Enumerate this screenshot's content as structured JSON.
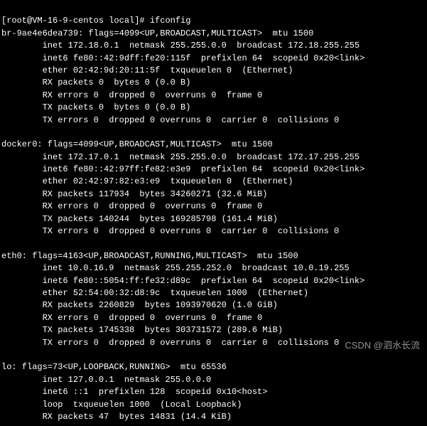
{
  "prompt": "[root@VM-16-9-centos local]# ",
  "command": "ifconfig",
  "interfaces": {
    "br": {
      "name": "br-9ae4e6dea739: flags=4099<UP,BROADCAST,MULTICAST>  mtu 1500",
      "inet": "        inet 172.18.0.1  netmask 255.255.0.0  broadcast 172.18.255.255",
      "inet6": "        inet6 fe80::42:9dff:fe20:115f  prefixlen 64  scopeid 0x20<link>",
      "ether": "        ether 02:42:9d:20:11:5f  txqueuelen 0  (Ethernet)",
      "rxp": "        RX packets 0  bytes 0 (0.0 B)",
      "rxe": "        RX errors 0  dropped 0  overruns 0  frame 0",
      "txp": "        TX packets 0  bytes 0 (0.0 B)",
      "txe": "        TX errors 0  dropped 0 overruns 0  carrier 0  collisions 0"
    },
    "docker0": {
      "name": "docker0: flags=4099<UP,BROADCAST,MULTICAST>  mtu 1500",
      "inet": "        inet 172.17.0.1  netmask 255.255.0.0  broadcast 172.17.255.255",
      "inet6": "        inet6 fe80::42:97ff:fe82:e3e9  prefixlen 64  scopeid 0x20<link>",
      "ether": "        ether 02:42:97:82:e3:e9  txqueuelen 0  (Ethernet)",
      "rxp": "        RX packets 117934  bytes 34260271 (32.6 MiB)",
      "rxe": "        RX errors 0  dropped 0  overruns 0  frame 0",
      "txp": "        TX packets 140244  bytes 169285798 (161.4 MiB)",
      "txe": "        TX errors 0  dropped 0 overruns 0  carrier 0  collisions 0"
    },
    "eth0": {
      "name": "eth0: flags=4163<UP,BROADCAST,RUNNING,MULTICAST>  mtu 1500",
      "inet": "        inet 10.0.16.9  netmask 255.255.252.0  broadcast 10.0.19.255",
      "inet6": "        inet6 fe80::5054:ff:fe32:d89c  prefixlen 64  scopeid 0x20<link>",
      "ether": "        ether 52:54:00:32:d8:9c  txqueuelen 1000  (Ethernet)",
      "rxp": "        RX packets 2260829  bytes 1093970620 (1.0 GiB)",
      "rxe": "        RX errors 0  dropped 0  overruns 0  frame 0",
      "txp": "        TX packets 1745338  bytes 303731572 (289.6 MiB)",
      "txe": "        TX errors 0  dropped 0 overruns 0  carrier 0  collisions 0"
    },
    "lo": {
      "name": "lo: flags=73<UP,LOOPBACK,RUNNING>  mtu 65536",
      "inet": "        inet 127.0.0.1  netmask 255.0.0.0",
      "inet6": "        inet6 ::1  prefixlen 128  scopeid 0x10<host>",
      "loop": "        loop  txqueuelen 1000  (Local Loopback)",
      "rxp": "        RX packets 47  bytes 14831 (14.4 KiB)"
    }
  },
  "watermark": "CSDN @泗水长流"
}
